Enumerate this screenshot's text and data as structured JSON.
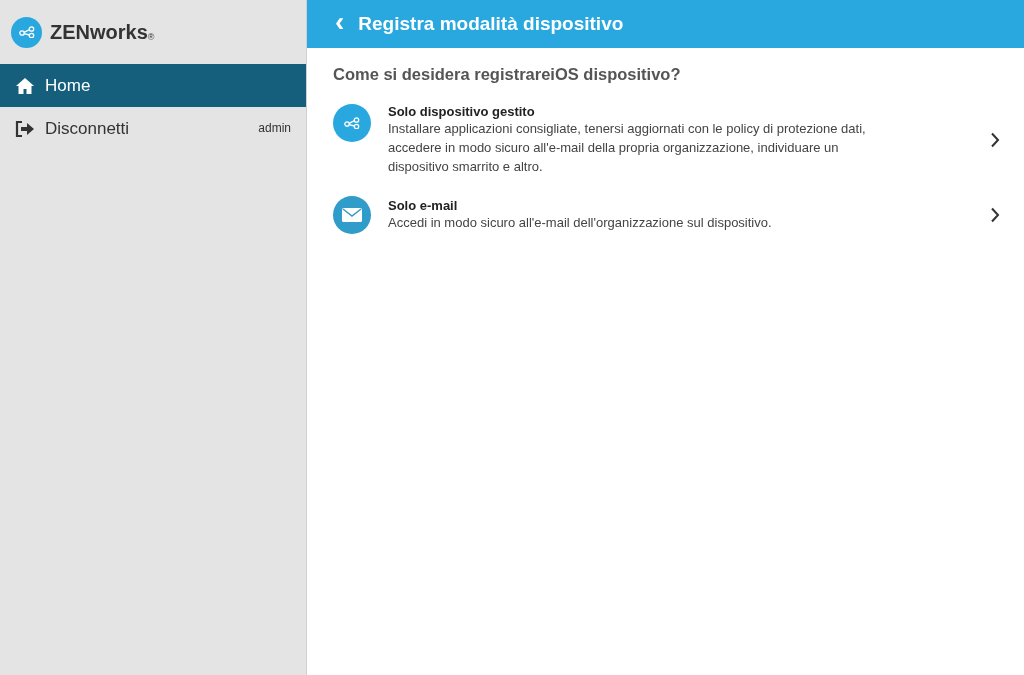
{
  "sidebar": {
    "logo": {
      "name": "ZENworks",
      "mark": "®"
    },
    "items": [
      {
        "label": "Home",
        "kind": "home",
        "selected": true
      },
      {
        "label": "Disconnetti",
        "kind": "logout",
        "selected": false,
        "note": "admin"
      }
    ]
  },
  "header": {
    "back": "‹",
    "title": "Registra modalità dispositivo"
  },
  "question": "Come si desidera registrareiOS dispositivo?",
  "options": [
    {
      "kind": "managed",
      "title": "Solo dispositivo gestito",
      "description": "Installare applicazioni consigliate, tenersi aggiornati con le policy di protezione dati, accedere in modo sicuro all'e-mail della propria organizzazione, individuare un dispositivo smarrito e altro."
    },
    {
      "kind": "email",
      "title": "Solo e-mail",
      "description": "Accedi in modo sicuro all'e-mail dell'organizzazione sul dispositivo."
    }
  ]
}
